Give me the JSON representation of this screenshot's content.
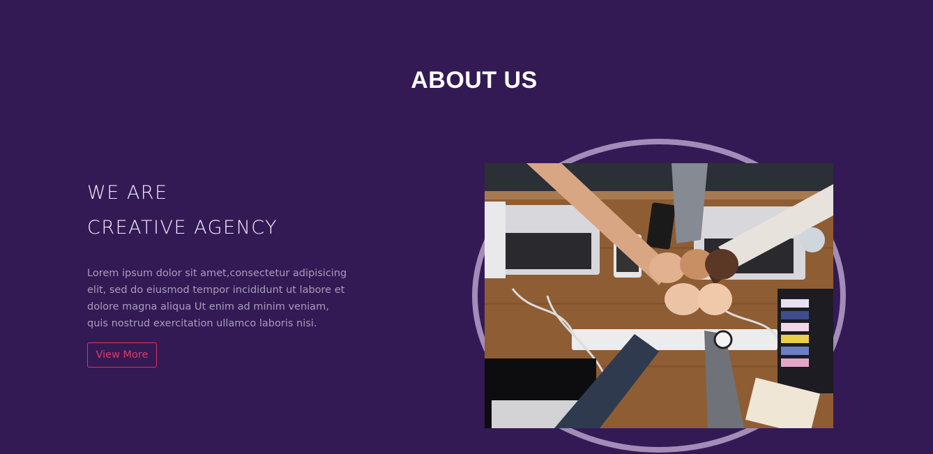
{
  "section": {
    "title": "ABOUT US"
  },
  "intro": {
    "headline_line1": "WE ARE",
    "headline_line2": "CREATIVE AGENCY",
    "description": "Lorem ipsum dolor sit amet,consectetur adipisicing elit, sed do eiusmod tempor incididunt ut labore et dolore magna aliqua Ut enim ad minim veniam, quis nostrud exercitation ullamco laboris nisi.",
    "button_label": "View More"
  },
  "photo": {
    "subject": "team-fist-bump-over-laptops"
  },
  "colors": {
    "background": "#341a55",
    "accent": "#e23a66",
    "ring": "#a18db8",
    "body_text": "#a99cba"
  }
}
